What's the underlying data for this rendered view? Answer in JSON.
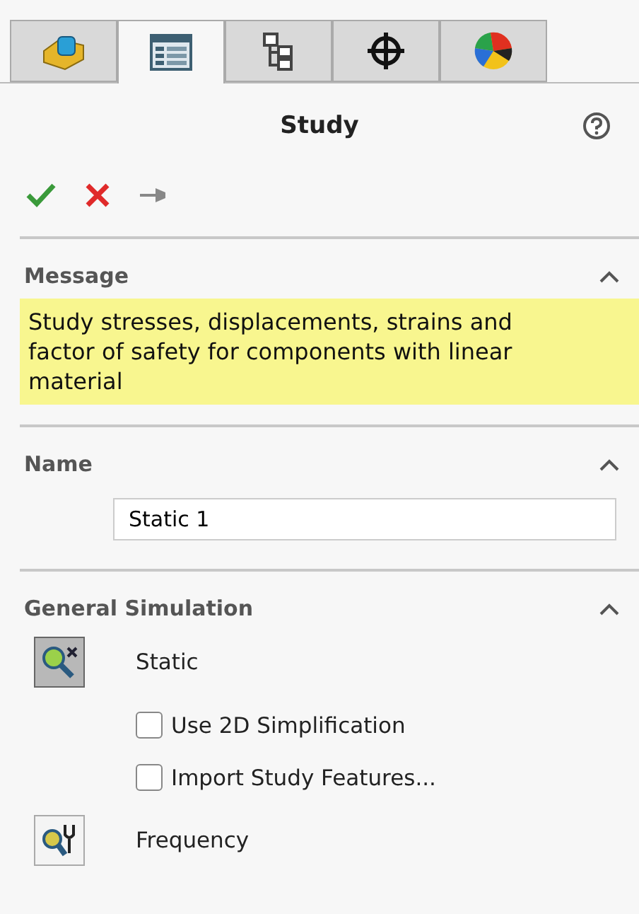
{
  "tabs": [
    {
      "kind": "part",
      "selected": false
    },
    {
      "kind": "property",
      "selected": true
    },
    {
      "kind": "config",
      "selected": false
    },
    {
      "kind": "target",
      "selected": false
    },
    {
      "kind": "appearance",
      "selected": false
    }
  ],
  "panel": {
    "title": "Study"
  },
  "sections": [
    {
      "kind": "message",
      "title": "Message",
      "expanded": true,
      "text": "Study stresses, displacements, strains and factor of safety  for components with linear material"
    },
    {
      "kind": "name",
      "title": "Name",
      "expanded": true,
      "value": "Static 1"
    },
    {
      "kind": "types",
      "title": "General Simulation",
      "expanded": true,
      "items": [
        {
          "kind": "static",
          "label": "Static",
          "selected": true
        },
        {
          "kind": "option",
          "label": "Use 2D Simplification",
          "checked": false
        },
        {
          "kind": "option",
          "label": "Import Study Features...",
          "checked": false
        },
        {
          "kind": "frequency",
          "label": "Frequency",
          "selected": false
        }
      ]
    }
  ]
}
